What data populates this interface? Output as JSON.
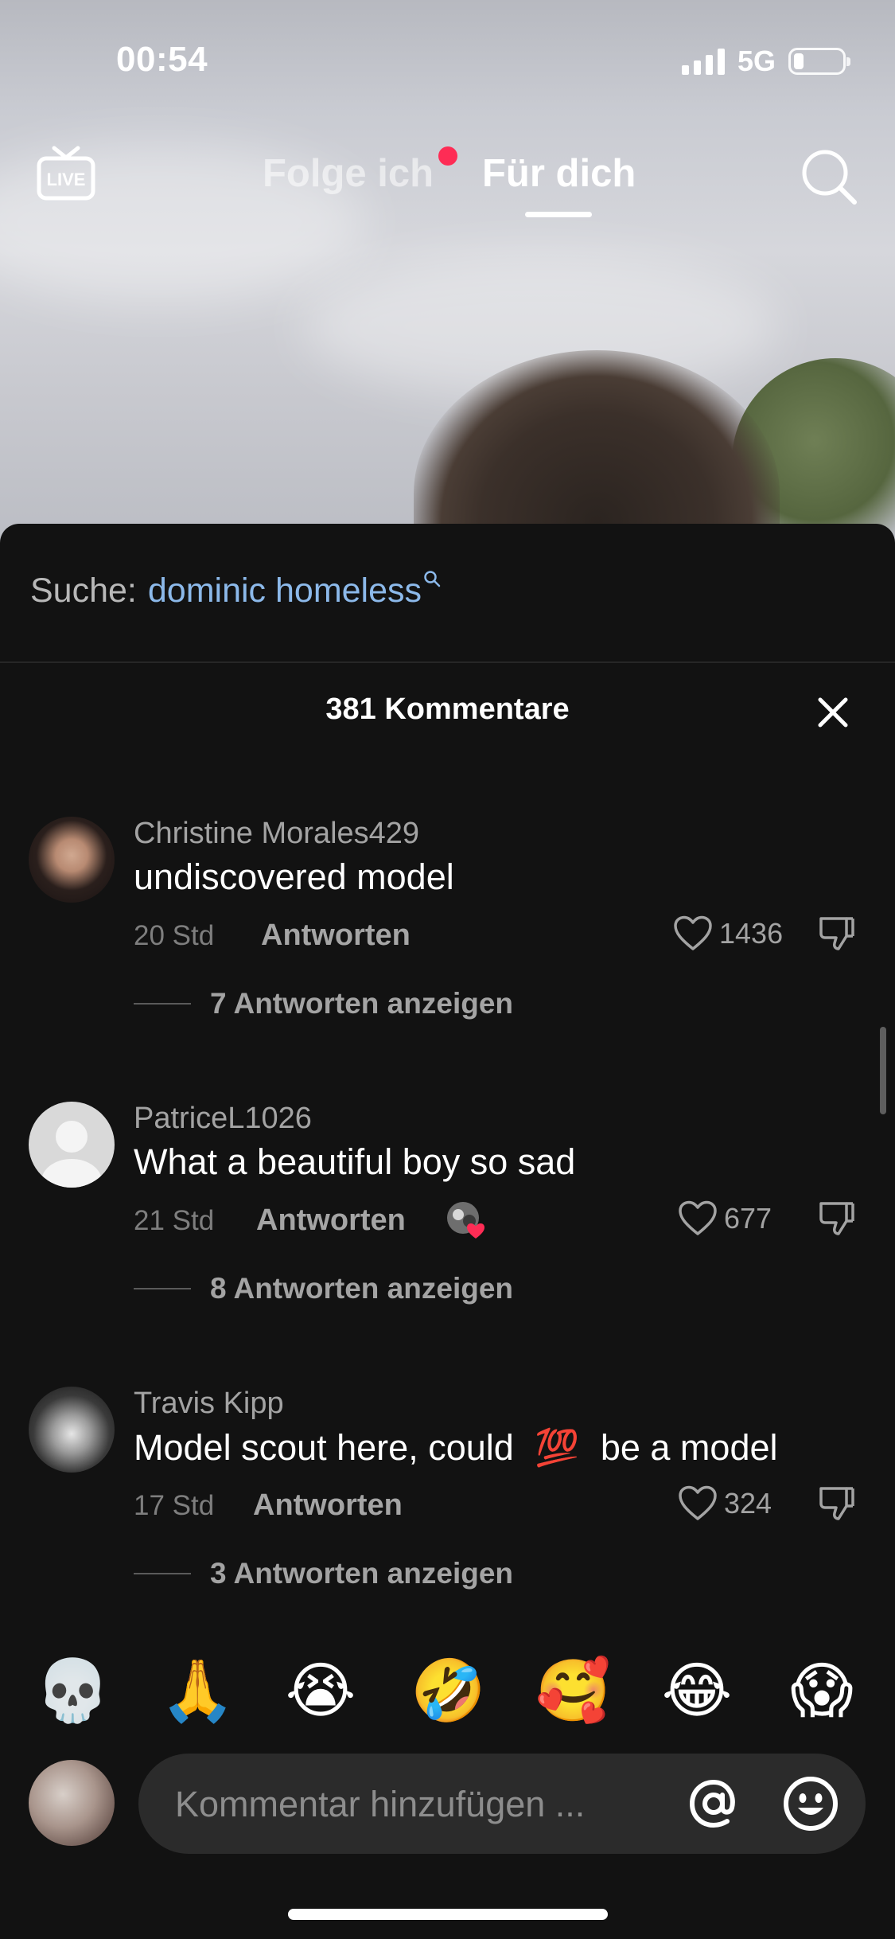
{
  "status_bar": {
    "time": "00:54",
    "network": "5G"
  },
  "top_nav": {
    "live_label": "LIVE",
    "tab_following": "Folge ich",
    "tab_for_you": "Für dich"
  },
  "sheet": {
    "search_prefix": "Suche:",
    "search_term": "dominic homeless",
    "comment_count": "381 Kommentare"
  },
  "comments": [
    {
      "author": "Christine Morales429",
      "text": "undiscovered model",
      "time": "20 Std",
      "reply_label": "Antworten",
      "likes": "1436",
      "view_replies": "7 Antworten anzeigen"
    },
    {
      "author": "PatriceL1026",
      "text": "What a beautiful boy so sad",
      "time": "21 Std",
      "reply_label": "Antworten",
      "likes": "677",
      "view_replies": "8 Antworten anzeigen"
    },
    {
      "author": "Travis Kipp",
      "text_before": "Model scout here, could",
      "text_emoji": "💯",
      "text_after": "be a model",
      "time": "17 Std",
      "reply_label": "Antworten",
      "likes": "324",
      "view_replies": "3 Antworten anzeigen"
    }
  ],
  "emoji_bar": [
    "💀",
    "🙏",
    "😭",
    "🤣",
    "🥰",
    "😂",
    "😱"
  ],
  "input": {
    "placeholder": "Kommentar hinzufügen ..."
  },
  "colors": {
    "sheet_bg": "#121212",
    "search_term": "#8cb9ea",
    "notification_dot": "#fe2c55",
    "input_bg": "#2b2b2b"
  }
}
